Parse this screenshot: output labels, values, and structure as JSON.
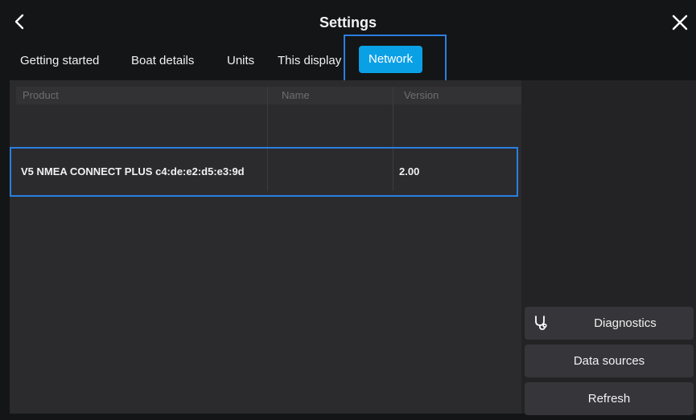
{
  "header": {
    "title": "Settings",
    "back_icon": "chevron-left-icon",
    "close_icon": "close-icon"
  },
  "tabs": [
    {
      "label": "Getting started",
      "active": false
    },
    {
      "label": "Boat details",
      "active": false
    },
    {
      "label": "Units",
      "active": false
    },
    {
      "label": "This display",
      "active": false
    },
    {
      "label": "Network",
      "active": true
    }
  ],
  "table": {
    "columns": [
      "Product",
      "Name",
      "Version"
    ],
    "rows": [
      {
        "product": "V5   NMEA CONNECT PLUS c4:de:e2:d5:e3:9d",
        "name": "",
        "version": "2.00"
      }
    ]
  },
  "side_buttons": {
    "diagnostics": "Diagnostics",
    "data_sources": "Data sources",
    "refresh": "Refresh",
    "diagnostics_icon": "stethoscope-icon"
  },
  "colors": {
    "accent": "#0aa0e6",
    "highlight_border": "#2a7fe0"
  }
}
